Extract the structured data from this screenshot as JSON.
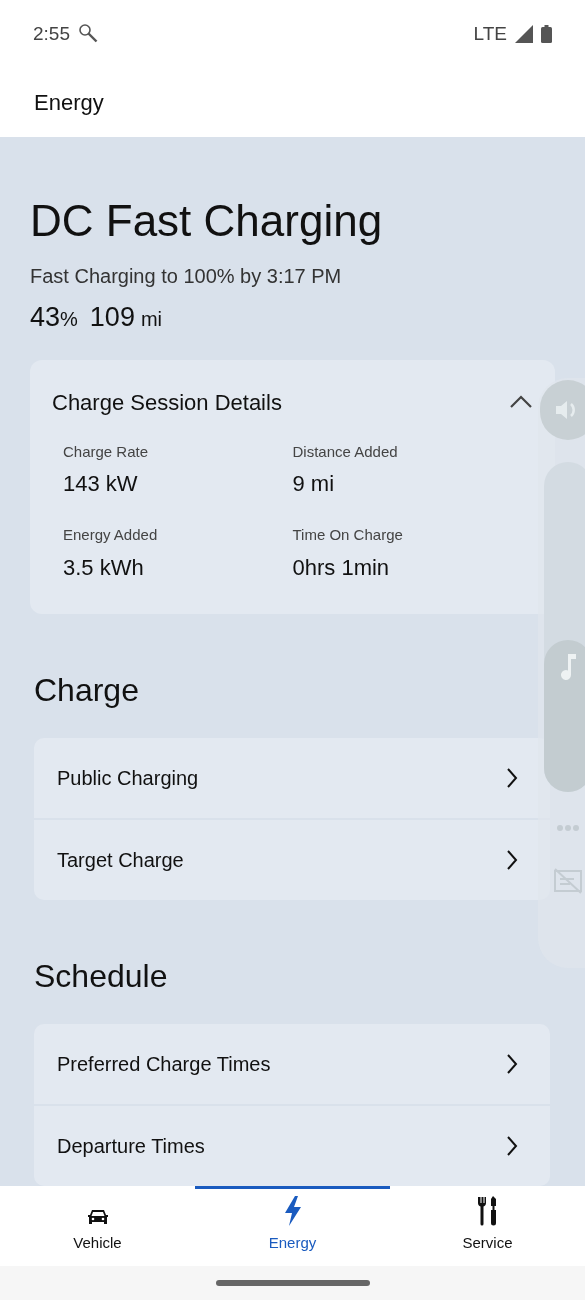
{
  "status_bar": {
    "time": "2:55",
    "network": "LTE"
  },
  "header": {
    "title": "Energy"
  },
  "charging": {
    "title": "DC Fast Charging",
    "subtitle": "Fast Charging to 100% by 3:17 PM",
    "battery": "43",
    "battery_unit": "%",
    "range": "109",
    "range_unit": "mi"
  },
  "details": {
    "title": "Charge Session Details",
    "expanded": true,
    "items": [
      {
        "label": "Charge Rate",
        "value": "143 kW"
      },
      {
        "label": "Distance Added",
        "value": "9 mi"
      },
      {
        "label": "Energy Added",
        "value": "3.5 kWh"
      },
      {
        "label": "Time On Charge",
        "value": "0hrs 1min"
      }
    ]
  },
  "sections": [
    {
      "title": "Charge",
      "items": [
        {
          "label": "Public Charging"
        },
        {
          "label": "Target Charge"
        }
      ]
    },
    {
      "title": "Schedule",
      "items": [
        {
          "label": "Preferred Charge Times"
        },
        {
          "label": "Departure Times"
        }
      ]
    }
  ],
  "volume": {
    "level": 0.46
  },
  "nav": [
    {
      "label": "Vehicle",
      "kind": "car",
      "selected": false
    },
    {
      "label": "Energy",
      "kind": "bolt",
      "selected": true
    },
    {
      "label": "Service",
      "kind": "tools",
      "selected": false
    }
  ]
}
